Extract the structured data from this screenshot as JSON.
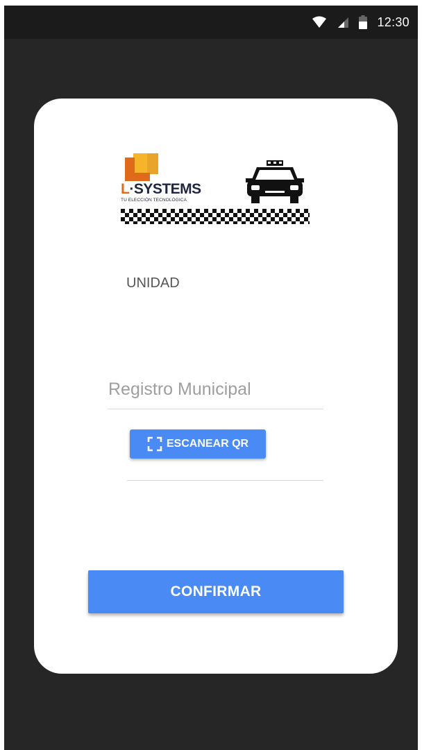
{
  "status_bar": {
    "time": "12:30",
    "icons": [
      "wifi-icon",
      "signal-icon",
      "battery-icon"
    ]
  },
  "logo": {
    "brand_prefix": "L",
    "brand_rest": "·SYSTEMS",
    "tagline": "TU ELECCIÓN TECNOLÓGICA",
    "secondary_icon": "taxi-icon"
  },
  "form": {
    "unit_label": "UNIDAD",
    "registro": {
      "placeholder": "Registro Municipal",
      "value": ""
    },
    "scan_button": {
      "icon": "qr-scan-icon",
      "label": "ESCANEAR QR"
    },
    "confirm_button": "CONFIRMAR"
  },
  "colors": {
    "background": "#262626",
    "status_bar": "#1b1b1b",
    "card": "#ffffff",
    "accent": "#4a8af4",
    "logo_orange": "#e06a1c",
    "logo_gold": "#f5b52a"
  }
}
